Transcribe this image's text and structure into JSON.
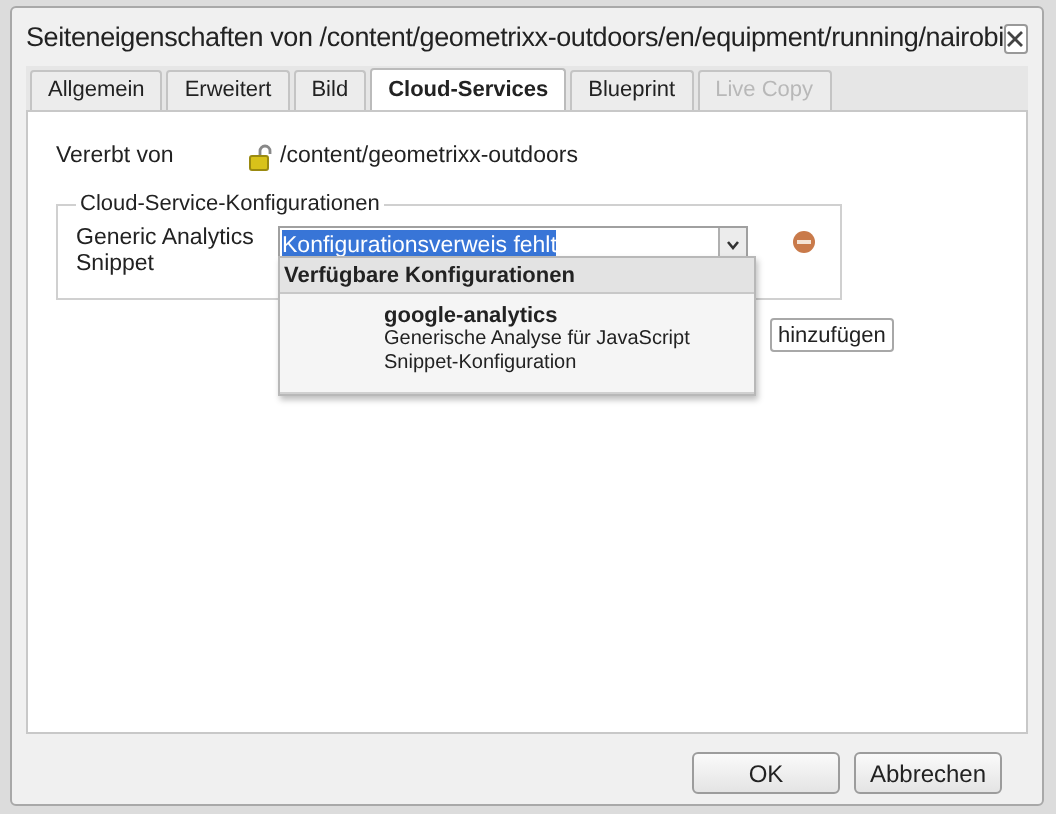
{
  "window": {
    "title": "Seiteneigenschaften von /content/geometrixx-outdoors/en/equipment/running/nairobi"
  },
  "tabs": [
    {
      "label": "Allgemein",
      "selected": false,
      "disabled": false
    },
    {
      "label": "Erweitert",
      "selected": false,
      "disabled": false
    },
    {
      "label": "Bild",
      "selected": false,
      "disabled": false
    },
    {
      "label": "Cloud-Services",
      "selected": true,
      "disabled": false
    },
    {
      "label": "Blueprint",
      "selected": false,
      "disabled": false
    },
    {
      "label": "Live Copy",
      "selected": false,
      "disabled": true
    }
  ],
  "inherited": {
    "label": "Vererbt von",
    "path": "/content/geometrixx-outdoors"
  },
  "fieldset": {
    "legend": "Cloud-Service-Konfigurationen",
    "rows": [
      {
        "label": "Generic Analytics Snippet",
        "value": "Konfigurationsverweis fehlt",
        "value_highlighted": true
      }
    ]
  },
  "dropdown": {
    "header": "Verfügbare Konfigurationen",
    "items": [
      {
        "name": "google-analytics",
        "description": "Generische Analyse für JavaScript Snippet-Konfiguration"
      }
    ]
  },
  "add_button": "hinzufügen",
  "buttons": [
    "OK",
    "Abbrechen"
  ]
}
